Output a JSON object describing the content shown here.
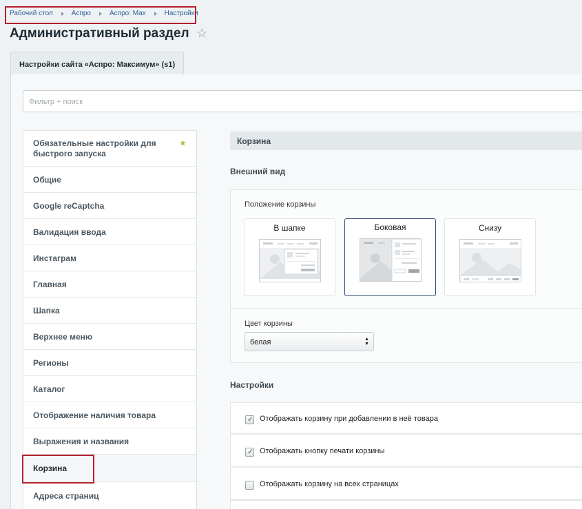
{
  "breadcrumb": {
    "items": [
      "Рабочий стол",
      "Аспро",
      "Аспро: Max",
      "Настройки"
    ]
  },
  "page": {
    "title": "Административный раздел",
    "star_icon": "star-icon"
  },
  "tab": {
    "label": "Настройки сайта «Аспро: Максимум» (s1)"
  },
  "filter": {
    "placeholder": "Фильтр + поиск"
  },
  "menu": {
    "items": [
      {
        "label": "Обязательные настройки для быстрого запуска",
        "starred": true
      },
      {
        "label": "Общие"
      },
      {
        "label": "Google reCaptcha"
      },
      {
        "label": "Валидация ввода"
      },
      {
        "label": "Инстаграм"
      },
      {
        "label": "Главная"
      },
      {
        "label": "Шапка"
      },
      {
        "label": "Верхнее меню"
      },
      {
        "label": "Регионы"
      },
      {
        "label": "Каталог"
      },
      {
        "label": "Отображение наличия товара"
      },
      {
        "label": "Выражения и названия"
      },
      {
        "label": "Корзина",
        "active": true
      },
      {
        "label": "Адреса страниц"
      }
    ]
  },
  "section": {
    "title": "Корзина",
    "appearance_heading": "Внешний вид",
    "position_label": "Положение корзины",
    "position_options": [
      {
        "label": "В шапке",
        "selected": false
      },
      {
        "label": "Боковая",
        "selected": true
      },
      {
        "label": "Снизу",
        "selected": false
      }
    ],
    "color_label": "Цвет корзины",
    "color_value": "белая",
    "settings_heading": "Настройки",
    "checkboxes": [
      {
        "label": "Отображать корзину при добавлении в неё товара",
        "checked": true
      },
      {
        "label": "Отображать кнопку печати корзины",
        "checked": true
      },
      {
        "label": "Отображать корзину на всех страницах",
        "checked": false
      }
    ]
  },
  "colors": {
    "highlight": "#b5212f",
    "link": "#2d5f99",
    "selected_border": "#2f4a7a"
  }
}
